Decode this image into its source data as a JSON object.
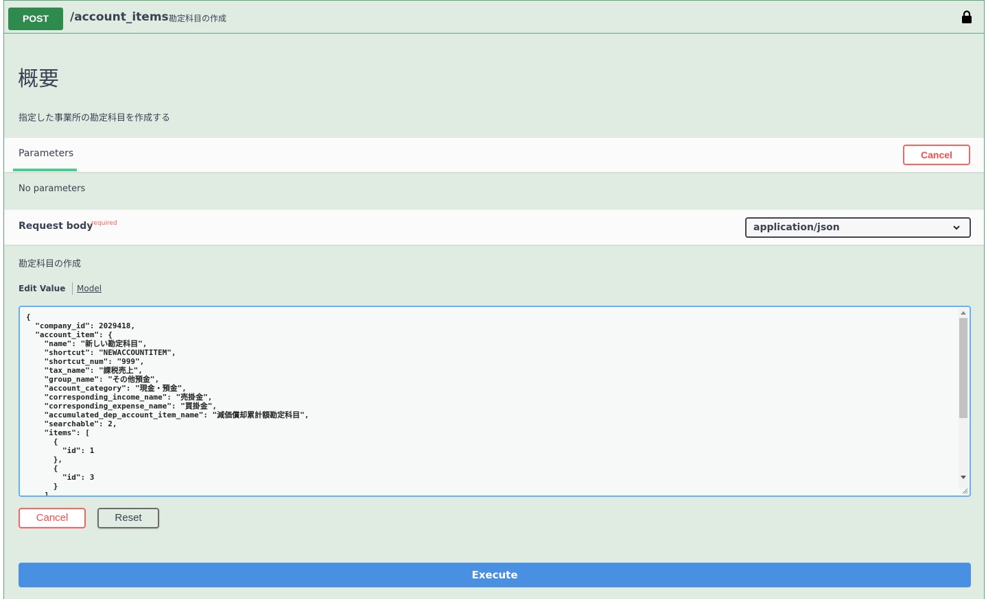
{
  "operation": {
    "method": "POST",
    "path": "/account_items",
    "summary": "勘定科目の作成"
  },
  "header": {
    "title": "概要",
    "description": "指定した事業所の勘定科目を作成する"
  },
  "parameters": {
    "tab_label": "Parameters",
    "cancel_label": "Cancel",
    "empty_text": "No parameters"
  },
  "request_body": {
    "label": "Request body",
    "required_label": "required",
    "content_type": "application/json",
    "description": "勘定科目の作成",
    "tabs": {
      "edit": "Edit Value",
      "model": "Model"
    },
    "value": "{\n  \"company_id\": 2029418,\n  \"account_item\": {\n    \"name\": \"新しい勘定科目\",\n    \"shortcut\": \"NEWACCOUNTITEM\",\n    \"shortcut_num\": \"999\",\n    \"tax_name\": \"課税売上\",\n    \"group_name\": \"その他預金\",\n    \"account_category\": \"現金・預金\",\n    \"corresponding_income_name\": \"売掛金\",\n    \"corresponding_expense_name\": \"買掛金\",\n    \"accumulated_dep_account_item_name\": \"減価償却累計額勘定科目\",\n    \"searchable\": 2,\n    \"items\": [\n      {\n        \"id\": 1\n      },\n      {\n        \"id\": 3\n      }\n    ]"
  },
  "actions": {
    "cancel_label": "Cancel",
    "reset_label": "Reset",
    "execute_label": "Execute"
  },
  "colors": {
    "method_bg": "#2f8a4d",
    "panel_bg": "#e0ebe2",
    "execute_bg": "#4990e2",
    "cancel_red": "#ff4a4a"
  }
}
